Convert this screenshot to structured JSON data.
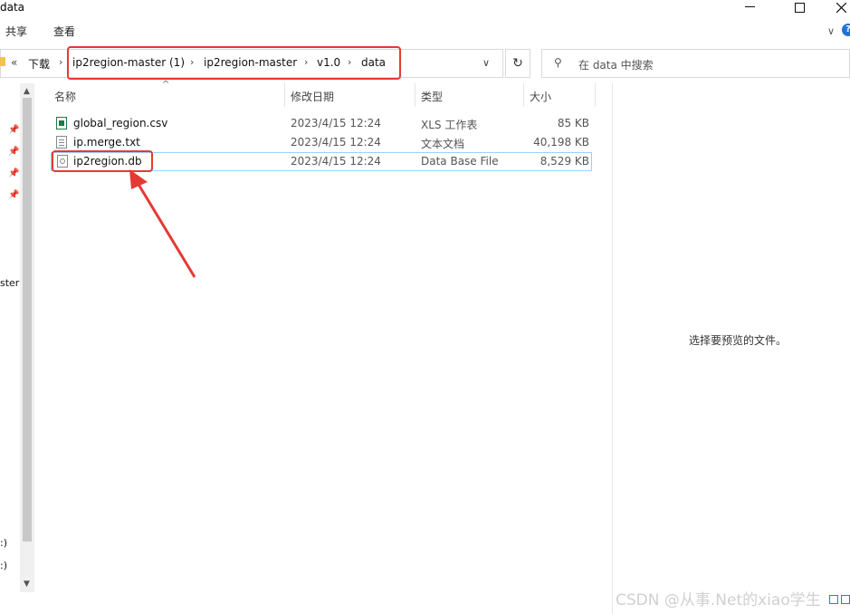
{
  "window": {
    "title": "data"
  },
  "ribbon": {
    "tabs": [
      "共享",
      "查看"
    ]
  },
  "address": {
    "overflow": "«",
    "crumbs": [
      "下载",
      "ip2region-master (1)",
      "ip2region-master",
      "v1.0",
      "data"
    ]
  },
  "search": {
    "placeholder": "在 data 中搜索"
  },
  "nav": {
    "items": [
      "ster",
      ":)",
      ":)"
    ]
  },
  "columns": {
    "name": "名称",
    "date": "修改日期",
    "type": "类型",
    "size": "大小"
  },
  "files": [
    {
      "name": "global_region.csv",
      "date": "2023/4/15 12:24",
      "type": "XLS 工作表",
      "size": "85 KB",
      "icon": "excel-file-icon"
    },
    {
      "name": "ip.merge.txt",
      "date": "2023/4/15 12:24",
      "type": "文本文档",
      "size": "40,198 KB",
      "icon": "text-file-icon"
    },
    {
      "name": "ip2region.db",
      "date": "2023/4/15 12:24",
      "type": "Data Base File",
      "size": "8,529 KB",
      "icon": "db-file-icon"
    }
  ],
  "preview": {
    "message": "选择要预览的文件。"
  },
  "watermark": "CSDN @从事.Net的xiao学生",
  "colors": {
    "highlight": "#e53935",
    "selection_border": "#99d1ff",
    "folder": "#f3c24b"
  }
}
